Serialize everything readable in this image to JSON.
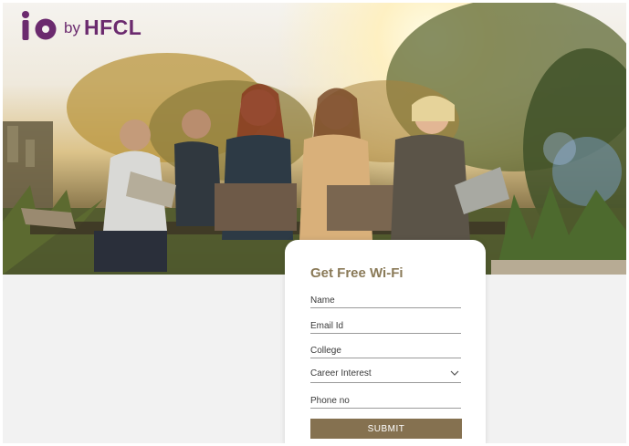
{
  "brand": {
    "by": "by",
    "name": "HFCL",
    "color": "#6b2a6e"
  },
  "hero": {
    "image": "photo-students-with-laptops"
  },
  "form": {
    "title": "Get Free Wi-Fi",
    "name_placeholder": "Name",
    "email_placeholder": "Email Id",
    "college_placeholder": "College",
    "career_label": "Career Interest",
    "phone_placeholder": "Phone no",
    "submit_label": "SUBMIT",
    "accent": "#857150"
  }
}
